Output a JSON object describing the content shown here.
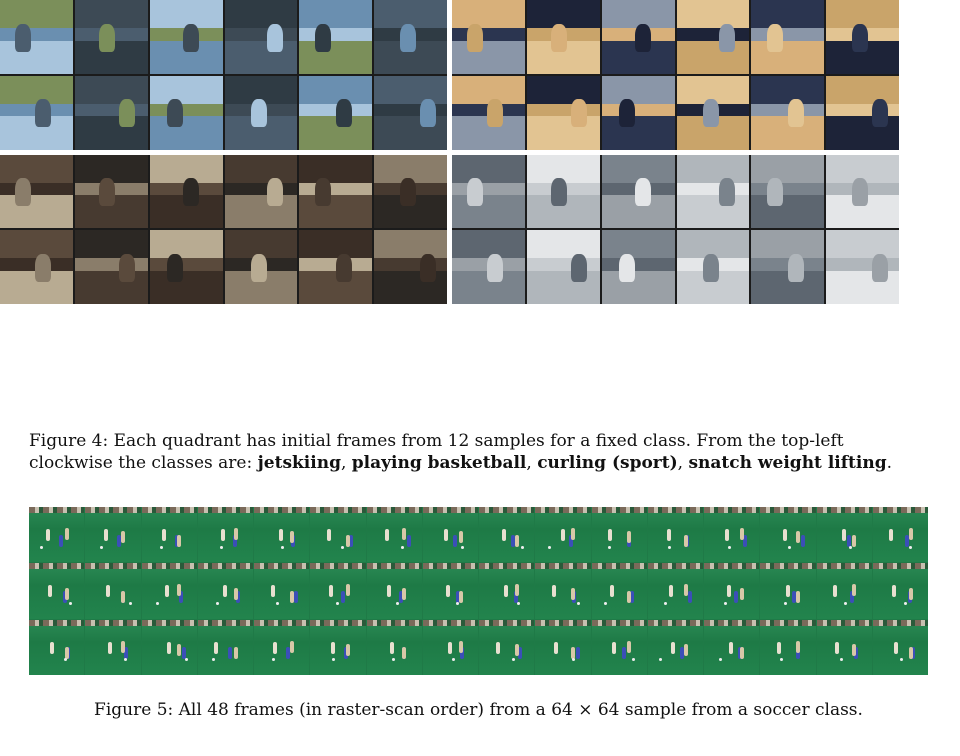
{
  "figure4": {
    "caption_lead": "Figure 4: Each quadrant has initial frames from 12 samples for a fixed class. From the top-left clockwise the classes are: ",
    "classes": [
      "jetskiing",
      "playing basketball",
      "curling (sport)",
      "snatch weight lifting"
    ],
    "caption_separators": [
      ", ",
      ", ",
      ", ",
      "."
    ],
    "quadrants": [
      {
        "class": "jetskiing",
        "palette": [
          "#6a8fb0",
          "#4b5d6e",
          "#7b8f5a",
          "#3d4a55",
          "#a8c4dc",
          "#2f3b44"
        ]
      },
      {
        "class": "playing basketball",
        "palette": [
          "#2b3550",
          "#c9a46a",
          "#d8b07a",
          "#1d2338",
          "#8a96a8",
          "#e2c492"
        ]
      },
      {
        "class": "snatch weight lifting",
        "palette": [
          "#3a2e26",
          "#8a7d6a",
          "#5a4a3c",
          "#2c2824",
          "#b8ab92",
          "#473a30"
        ]
      },
      {
        "class": "curling (sport)",
        "palette": [
          "#9aa0a6",
          "#c8ccd0",
          "#5d6670",
          "#e4e6e8",
          "#7a838c",
          "#b0b6bb"
        ]
      }
    ]
  },
  "figure5": {
    "caption_prefix": "Figure 5: All 48 frames (in raster-scan order) from a ",
    "caption_math": "64 × 64",
    "caption_suffix": " sample from a soccer class.",
    "frames": 48
  }
}
